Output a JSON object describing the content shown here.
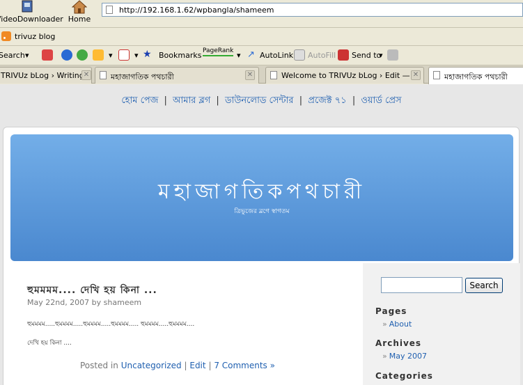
{
  "browser": {
    "toolbar": {
      "videodownloader_label": "VideoDownloader",
      "home_label": "Home",
      "url": "http://192.168.1.62/wpbangla/shameem"
    },
    "bookmarks_bar": {
      "rss_label": "trivuz blog"
    },
    "extensions": {
      "search_label": "Search",
      "bookmarks_label": "Bookmarks",
      "pagerank_label": "PageRank",
      "autolink_label": "AutoLink",
      "autofill_label": "AutoFill",
      "sendto_label": "Send to"
    },
    "tabs": [
      {
        "title": "TRIVUz bLog › Writing ..."
      },
      {
        "title": "মহাজাগতিক পথচারী"
      },
      {
        "title": "Welcome to TRIVUz bLog › Edit — ..."
      },
      {
        "title": "মহাজাগতিক পথচারী"
      }
    ]
  },
  "page": {
    "topnav": [
      {
        "label": "হোম পেজ"
      },
      {
        "label": "আমার ব্লগ"
      },
      {
        "label": "ডাউনলোড সেন্টার"
      },
      {
        "label": "প্রজেক্ট ৭১"
      },
      {
        "label": "ওয়ার্ড প্রেস"
      }
    ],
    "header": {
      "title": "মহাজাগতিকপথচারী",
      "description": "ত্রিভুজের ব্লগে স্বাগতম"
    },
    "post": {
      "title": "হুমমমম.... দেখি হয় কিনা ...",
      "meta": "May 22nd, 2007 by shameem",
      "paragraph1": "হুমমমম.....হুমমমম.....হুমমমম.....হুমমমম..... হুমমমম.....হুমমমম....",
      "paragraph2": "দেখি হয় কিনা ....",
      "footer_prefix": "Posted in",
      "category_link": "Uncategorized",
      "sep1": "|",
      "edit_link": "Edit",
      "sep2": "|",
      "comments_link": "7 Comments »"
    },
    "sidebar": {
      "search_button": "Search",
      "pages_heading": "Pages",
      "pages": [
        {
          "label": "About"
        }
      ],
      "archives_heading": "Archives",
      "archives": [
        {
          "label": "May 2007"
        }
      ],
      "categories_heading": "Categories"
    }
  },
  "colors": {
    "link": "#2060b0",
    "header_top": "#73aee8",
    "header_bottom": "#4a88cf"
  }
}
